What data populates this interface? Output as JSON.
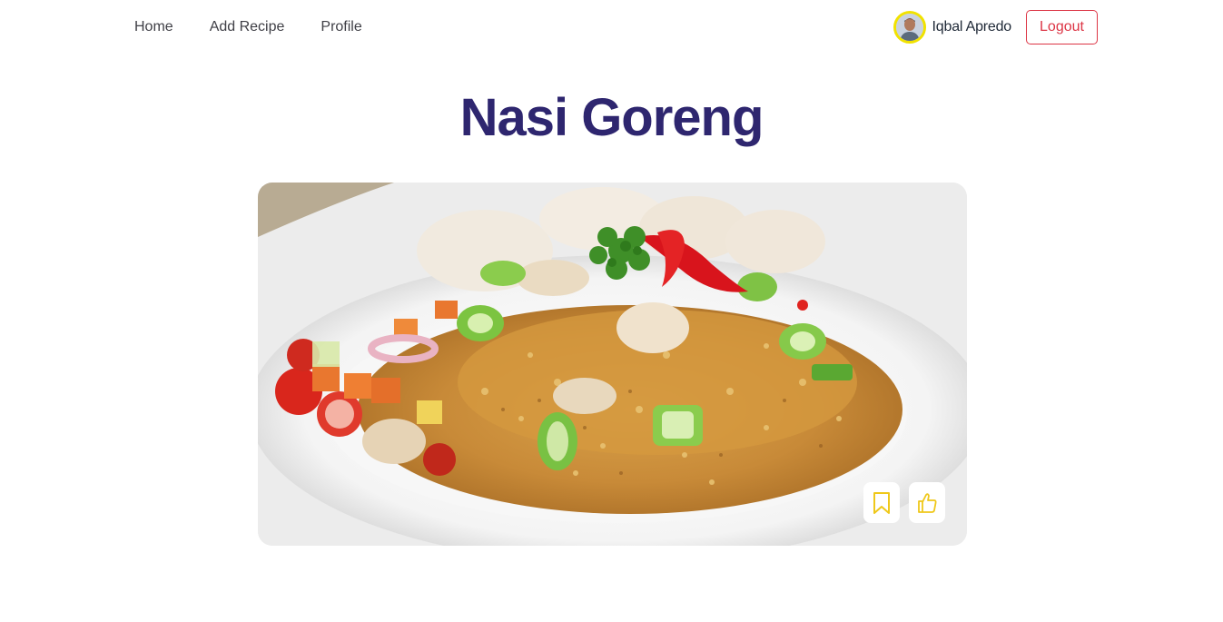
{
  "nav": {
    "links": [
      {
        "label": "Home"
      },
      {
        "label": "Add Recipe"
      },
      {
        "label": "Profile"
      }
    ]
  },
  "user": {
    "name": "Iqbal Apredo",
    "logout_label": "Logout",
    "avatar_icon": "user-avatar"
  },
  "recipe": {
    "title": "Nasi Goreng",
    "image_alt_icon": "nasi-goreng-photo",
    "actions": {
      "save_icon": "bookmark-icon",
      "like_icon": "thumbs-up-icon"
    }
  },
  "colors": {
    "title": "#2e266f",
    "logout": "#dc3545",
    "avatar_ring": "#f1e200",
    "action_icon": "#efc81a"
  }
}
